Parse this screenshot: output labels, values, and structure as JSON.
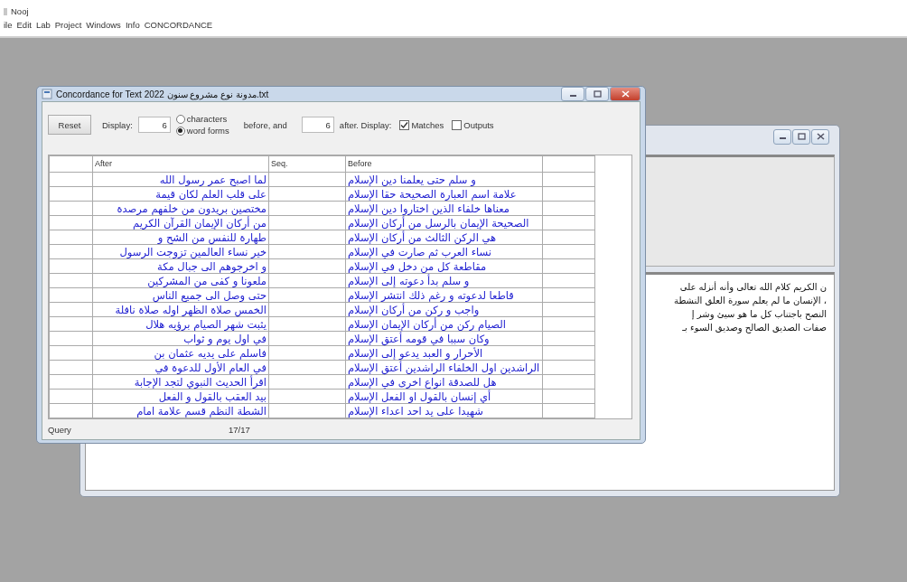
{
  "app": {
    "title": "Nooj"
  },
  "menu": {
    "file": "ile",
    "edit": "Edit",
    "lab": "Lab",
    "project": "Project",
    "windows": "Windows",
    "info": "Info",
    "concordance": "CONCORDANCE"
  },
  "back_window": {
    "text_lines": [
      "ن الكريم كلام الله تعالى وأنه أنزله على",
      "، الإنسان ما لم يعلم سورة العلق النشطة",
      "النصح باجتناب كل ما هو سيئ وشر إ",
      "صفات الصديق الصالح وصديق السوء بـ"
    ]
  },
  "dialog": {
    "title": "Concordance for Text 2022 مدونة نوع مشروع سنون.txt",
    "reset": "Reset",
    "display_label": "Display:",
    "before_value": "6",
    "mode_options": [
      {
        "label": "characters",
        "selected": false
      },
      {
        "label": "word forms",
        "selected": true
      }
    ],
    "before_and": "before, and",
    "after_value": "6",
    "after_display": "after. Display:",
    "checks": {
      "matches": {
        "label": "Matches",
        "checked": true
      },
      "outputs": {
        "label": "Outputs",
        "checked": false
      }
    },
    "columns": {
      "after": "After",
      "seq": "Seq.",
      "before": "Before"
    },
    "rows": [
      {
        "after": "لما اصبح عمر رسول الله",
        "before": "و سلم حتى يعلمنا دين الإسلام"
      },
      {
        "after": "على قلب العلم لكان قيمة",
        "before": "علامة اسم العبارة الصحيحة حقا الإسلام"
      },
      {
        "after": "مختصين بريدون من خلفهم مرصدة",
        "before": "معناها خلفاء الذين اختاروا دين الإسلام"
      },
      {
        "after": "من أركان الإيمان القرآن الكريم",
        "before": "الصحيحة الإيمان بالرسل من أركان الإسلام"
      },
      {
        "after": "طهارة للنفس من الشح و",
        "before": "هي الركن الثالث من أركان الإسلام"
      },
      {
        "after": "خير نساء العالمين تزوجت الرسول",
        "before": "نساء العرب ثم صارت في الإسلام"
      },
      {
        "after": "و اخرجوهم الى جبال مكة",
        "before": "مقاطعة كل من دخل في الإسلام"
      },
      {
        "after": "ملعونا و كفى من المشركين",
        "before": "و سلم بدأ دعوته إلى الإسلام"
      },
      {
        "after": "حتى وصل الى جميع الناس",
        "before": "قاطعا لدعوته و رغم ذلك انتشر الإسلام"
      },
      {
        "after": "الخمس صلاة الظهر اوله صلاة نافلة",
        "before": "واجب و ركن من أركان الإسلام"
      },
      {
        "after": "يثبت شهر الصيام برؤيه هلال",
        "before": "الصيام ركن من أركان الإيمان الإسلام"
      },
      {
        "after": "في اول يوم و ثواب",
        "before": "وكان سببا في قومه أعتق الإسلام"
      },
      {
        "after": "فاسلم على يديه عثمان بن",
        "before": "الأحرار و العبد يدعو إلى الإسلام"
      },
      {
        "after": "في العام الأول للدعوة في",
        "before": "الراشدين اول الخلفاء الراشدين أعتق الإسلام"
      },
      {
        "after": "اقرأ الحديث النبوي لتجد الإجابة",
        "before": "هل للصدقة انواع اخرى في الإسلام"
      },
      {
        "after": "بيد العقب بالقول و الفعل",
        "before": "أي إنسان بالقول او الفعل الإسلام"
      },
      {
        "after": "الشطة النظم قسم علامة امام",
        "before": "شهيدا على يد احد اعداء الإسلام"
      }
    ],
    "status": {
      "query": "Query",
      "count": "17/17"
    }
  }
}
